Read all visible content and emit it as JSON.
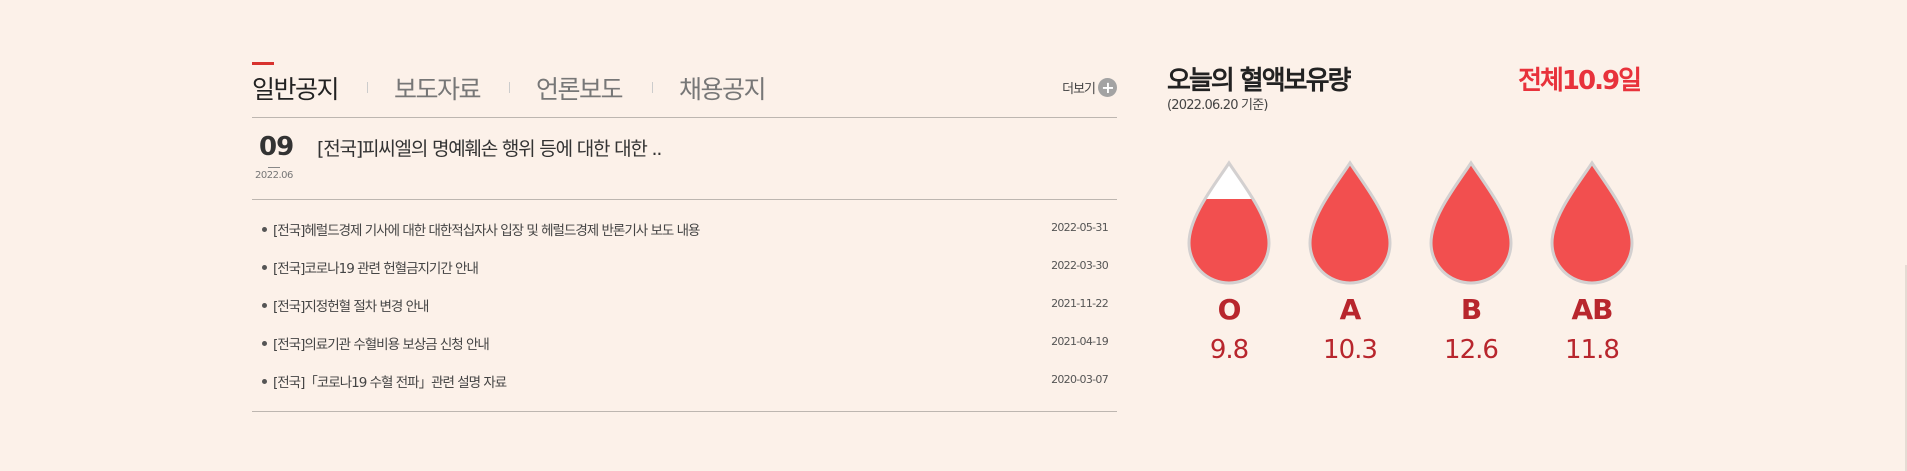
{
  "notice": {
    "tabs": [
      {
        "label": "일반공지",
        "active": true
      },
      {
        "label": "보도자료",
        "active": false
      },
      {
        "label": "언론보도",
        "active": false
      },
      {
        "label": "채용공지",
        "active": false
      }
    ],
    "more_label": "더보기",
    "more_icon": "plus-circle-icon",
    "featured": {
      "day": "09",
      "month": "2022.06",
      "title": "[전국]피씨엘의 명예훼손 행위 등에 대한 대한 .."
    },
    "items": [
      {
        "title": "[전국]헤럴드경제 기사에 대한 대한적십자사 입장 및 헤럴드경제 반론기사 보도 내용",
        "date": "2022-05-31"
      },
      {
        "title": "[전국]코로나19 관련 헌혈금지기간 안내",
        "date": "2022-03-30"
      },
      {
        "title": "[전국]지정헌혈 절차 변경 안내",
        "date": "2021-11-22"
      },
      {
        "title": "[전국]의료기관 수혈비용 보상금 신청 안내",
        "date": "2021-04-19"
      },
      {
        "title": "[전국]「코로나19 수혈 전파」관련 설명 자료",
        "date": "2020-03-07"
      }
    ]
  },
  "blood": {
    "title": "오늘의 혈액보유량",
    "date": "(2022.06.20 기준)",
    "total": "전체10.9일",
    "colors": {
      "fill": "#f24f4f",
      "outline": "#d3d0d0",
      "empty": "#ffffff",
      "label": "#b8262d",
      "total": "#e8323b"
    },
    "types": [
      {
        "type": "O",
        "days": "9.8",
        "fill_level": 0.7
      },
      {
        "type": "A",
        "days": "10.3",
        "fill_level": 1.0
      },
      {
        "type": "B",
        "days": "12.6",
        "fill_level": 1.0
      },
      {
        "type": "AB",
        "days": "11.8",
        "fill_level": 1.0
      }
    ]
  }
}
